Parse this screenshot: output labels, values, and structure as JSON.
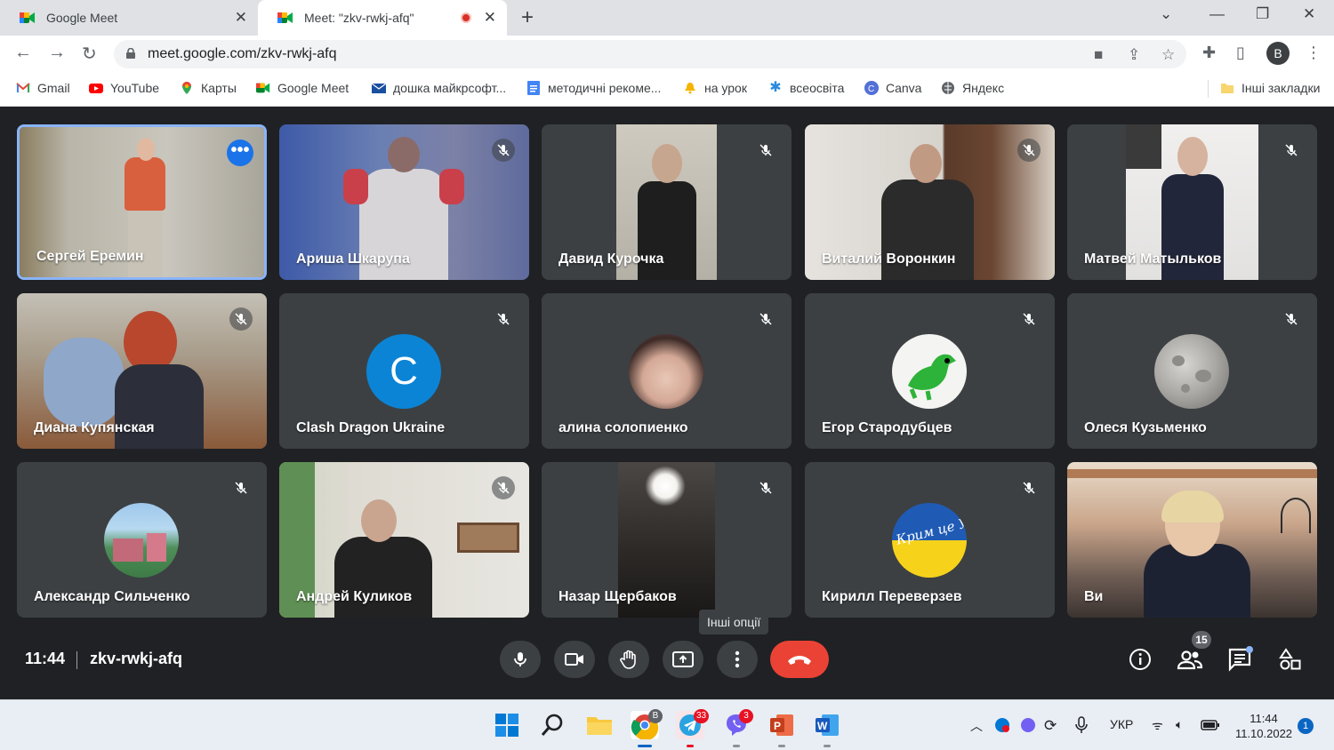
{
  "browser": {
    "tabs": [
      {
        "title": "Google Meet"
      },
      {
        "title": "Meet: \"zkv-rwkj-afq\""
      }
    ],
    "url": "meet.google.com/zkv-rwkj-afq",
    "profile_initial": "B",
    "bookmarks": [
      {
        "label": "Gmail",
        "icon": "gmail-icon"
      },
      {
        "label": "YouTube",
        "icon": "youtube-icon"
      },
      {
        "label": "Карты",
        "icon": "maps-icon"
      },
      {
        "label": "Google Meet",
        "icon": "meet-icon"
      },
      {
        "label": "дошка майкрсофт...",
        "icon": "mail-icon"
      },
      {
        "label": "методичні рекоме...",
        "icon": "docs-icon"
      },
      {
        "label": "на урок",
        "icon": "bell-icon"
      },
      {
        "label": "всеосвіта",
        "icon": "snowflake-icon"
      },
      {
        "label": "Canva",
        "icon": "canva-icon"
      },
      {
        "label": "Яндекс",
        "icon": "globe-icon"
      }
    ],
    "other_bookmarks": "Інші закладки"
  },
  "meet": {
    "participants": [
      {
        "name": "Сергей Еремин",
        "muted": false,
        "pinned_more": true
      },
      {
        "name": "Ариша Шкарупа",
        "muted": true
      },
      {
        "name": "Давид Курочка",
        "muted": true
      },
      {
        "name": "Виталий Воронкин",
        "muted": true
      },
      {
        "name": "Матвей Матыльков",
        "muted": true
      },
      {
        "name": "Диана Купянская",
        "muted": true
      },
      {
        "name": "Clash Dragon Ukraine",
        "muted": true,
        "avatar_letter": "C"
      },
      {
        "name": "алина солопиенко",
        "muted": true
      },
      {
        "name": "Егор Стародубцев",
        "muted": true
      },
      {
        "name": "Олеся Кузьменко",
        "muted": true
      },
      {
        "name": "Александр Сильченко",
        "muted": true
      },
      {
        "name": "Андрей Куликов",
        "muted": true
      },
      {
        "name": "Назар Щербаков",
        "muted": true
      },
      {
        "name": "Кирилл Переверзев",
        "muted": true,
        "avatar_text": "Крим це Україна"
      },
      {
        "name": "Ви",
        "muted": false
      }
    ],
    "time": "11:44",
    "meeting_code": "zkv-rwkj-afq",
    "tooltip": "Інші опції",
    "people_count": "15",
    "accent_color": "#8ab4f8",
    "end_call_color": "#ea4335"
  },
  "taskbar": {
    "telegram_badge": "33",
    "viber_badge": "3",
    "chrome_badge": "B",
    "language": "УКР",
    "clock_time": "11:44",
    "clock_date": "11.10.2022",
    "notifications": "1"
  }
}
